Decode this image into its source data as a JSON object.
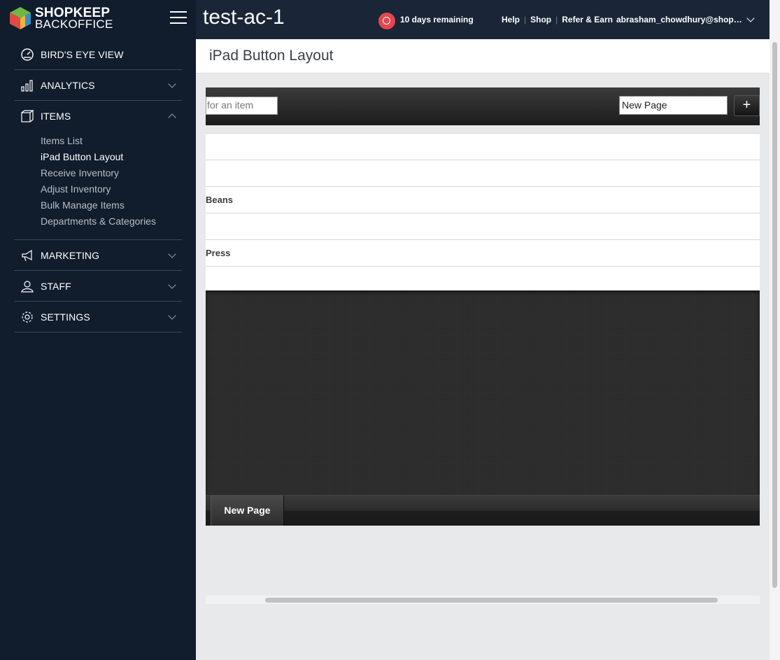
{
  "brand": {
    "line1": "SHOPKEEP",
    "line2": "BACKOFFICE"
  },
  "store_name": "test-ac-1",
  "trial": {
    "text": "10 days remaining"
  },
  "top_links": {
    "help": "Help",
    "shop": "Shop",
    "refer": "Refer & Earn"
  },
  "user": {
    "email": "abrasham_chowdhury@shopkeep.com"
  },
  "nav": {
    "birds_eye": "BIRD'S EYE VIEW",
    "analytics": "ANALYTICS",
    "items": "ITEMS",
    "items_sub": [
      "Items List",
      "iPad Button Layout",
      "Receive Inventory",
      "Adjust Inventory",
      "Bulk Manage Items",
      "Departments & Categories"
    ],
    "marketing": "MARKETING",
    "staff": "STAFF",
    "settings": "SETTINGS"
  },
  "page": {
    "title": "iPad Button Layout"
  },
  "editor": {
    "search_text": "for an item",
    "new_page_value": "New Page",
    "add_label": "+",
    "rows": [
      "",
      "",
      "Beans",
      "",
      " Press",
      ""
    ],
    "tab_label": "New Page"
  }
}
